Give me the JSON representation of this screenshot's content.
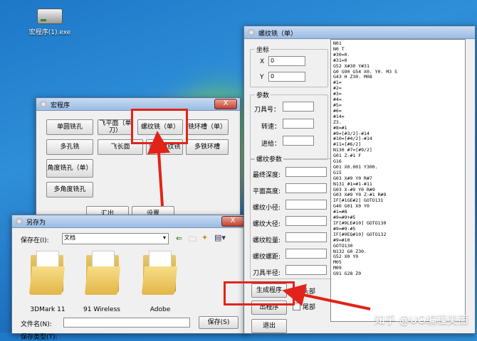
{
  "desktop": {
    "icon_label": "宏程序(1).exe"
  },
  "macro_window": {
    "title": "宏程序",
    "close": "X",
    "buttons": [
      "单圆铣孔",
      "飞平面（单刀）",
      "螺纹铣（单）",
      "铣环槽（单）",
      "多孔铣",
      "飞长面",
      "多孔螺纹铣",
      "多铁环槽",
      "角度铣孔（单）",
      "多角度铣孔",
      "汇出",
      "设置"
    ]
  },
  "thread_window": {
    "title": "螺纹铣（单）",
    "coord": {
      "label": "坐标",
      "x_label": "X",
      "x_value": "0",
      "y_label": "Y",
      "y_value": "0"
    },
    "params": {
      "label": "参数",
      "tool": "刀具号：",
      "speed": "转速：",
      "feed": "进给："
    },
    "thread": {
      "label": "螺纹参数",
      "fields": [
        "最终深度:",
        "平面高度:",
        "螺纹小径:",
        "螺纹大径:",
        "螺纹粒量:",
        "螺纹螺距:",
        "刀具半径:"
      ]
    },
    "gen_button": "生成程序",
    "out_button": "出程序",
    "exit_button": "退出",
    "head_label": "头部",
    "tail_label": "尾部",
    "code": "N01\nN0 T\n#30=0.\n#31=0\nG52 X#30 Y#31\nG0 G90 G54 X0. Y0. M3 S\nG43 H Z30. M08\n#1=\n#2=\n#3=\n#4=\n#5=\n#6=\n#14=\nZ3.\n#8=#1\n#9=[#3/2]-#14\n#10=[#4/2]-#14\n#11=[#6/2]\nN130 #7=[#9/2]\nG01 Z-#1 F\nG16\nG01 X0.001 Y300.\nG15\nG03 X#9 Y0 R#7\nN131 #1=#1-#11\nG03 X-#9 Y0 R#9\nG03 X#9 Y0 Z-#1 R#9\nIF[#1GE#2] GOTO131\nG40 G01 X0 Y0\n#1=#8\n#9=#9+#5\nIF[#9LE#10] GOTO130\n#9=#9-#5\nIF[#9EQ#10] GOTO132\n#9=#10\nGOTO130\nN132 G0 Z30.\nG52 X0 Y0\nM05\nM09\nG91 G28 Z0"
  },
  "saveas_window": {
    "title": "另存为",
    "close": "X",
    "save_in_label": "保存在(I):",
    "save_in_value": "文档",
    "folders": [
      "3DMark 11",
      "91 Wireless",
      "Adobe"
    ],
    "filename_label": "文件名(N):",
    "filetype_label": "保存类型(T):",
    "save_button": "保存(S)"
  },
  "watermark": "知乎 @UG编程美丽",
  "colors": {
    "accent_red": "#e2231a"
  }
}
